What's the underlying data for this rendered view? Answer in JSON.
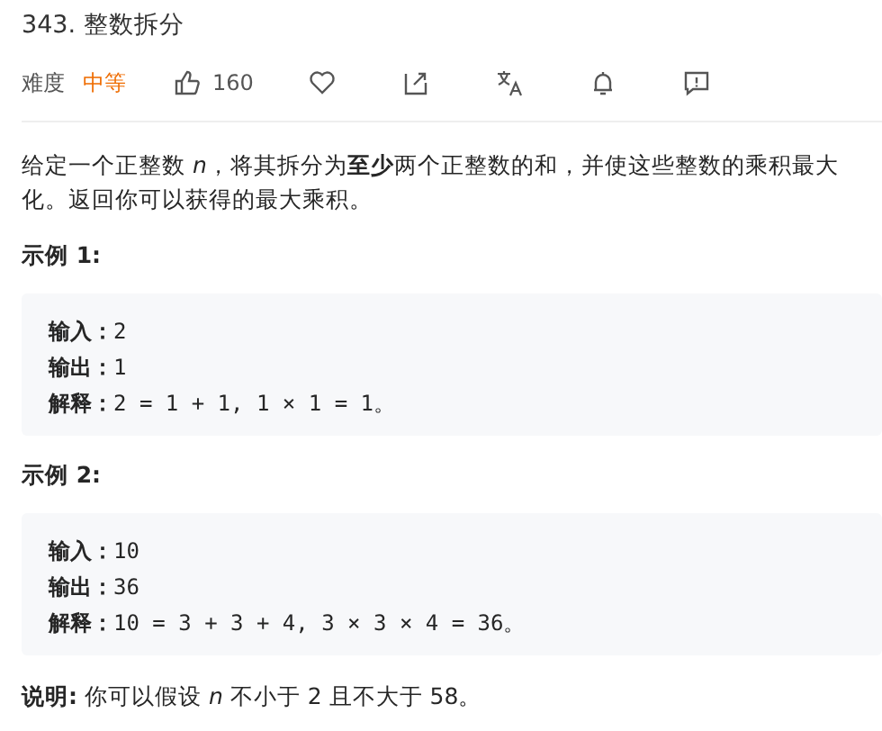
{
  "title": "343. 整数拆分",
  "meta": {
    "difficulty_label": "难度",
    "difficulty": "中等",
    "likes": "160"
  },
  "description": "给定一个正整数 *n*，将其拆分为**至少**两个正整数的和，并使这些整数的乘积最大化。返回你可以获得的最大乘积。",
  "examples": [
    {
      "heading": "示例 1:",
      "lines": [
        "**输入：**2",
        "**输出：**1",
        "**解释：**2 = 1 + 1, 1 × 1 = 1。"
      ]
    },
    {
      "heading": "示例 2:",
      "lines": [
        "**输入：**10",
        "**输出：**36",
        "**解释：**10 = 3 + 3 + 4, 3 × 3 × 4 = 36。"
      ]
    }
  ],
  "note": "**说明:** 你可以假设 *n* 不小于 2 且不大于 58。"
}
